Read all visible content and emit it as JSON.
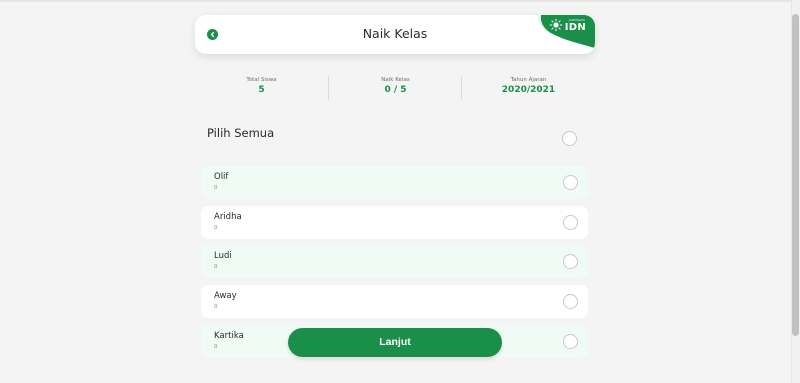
{
  "header": {
    "title": "Naik Kelas",
    "back_icon": "chevron-left-icon",
    "brand": {
      "name": "IDN",
      "tagline": "JARINGAN",
      "icon": "sun-icon",
      "color": "#1a8f4a"
    }
  },
  "stats": [
    {
      "label": "Total Siswa",
      "value": "5"
    },
    {
      "label": "Naik Kelas",
      "value": "0 / 5"
    },
    {
      "label": "Tahun Ajaran",
      "value": "2020/2021"
    }
  ],
  "select_all": {
    "label": "Pilih Semua",
    "checked": false
  },
  "students": [
    {
      "name": "Olif",
      "sub": "0",
      "checked": false
    },
    {
      "name": "Aridha",
      "sub": "0",
      "checked": false
    },
    {
      "name": "Ludi",
      "sub": "0",
      "checked": false
    },
    {
      "name": "Away",
      "sub": "0",
      "checked": false
    },
    {
      "name": "Kartika",
      "sub": "0",
      "checked": false
    }
  ],
  "next_button": {
    "label": "Lanjut"
  },
  "colors": {
    "accent": "#1a8f4a",
    "background": "#f3f4f3",
    "card_alt": "#f0fbf6"
  }
}
